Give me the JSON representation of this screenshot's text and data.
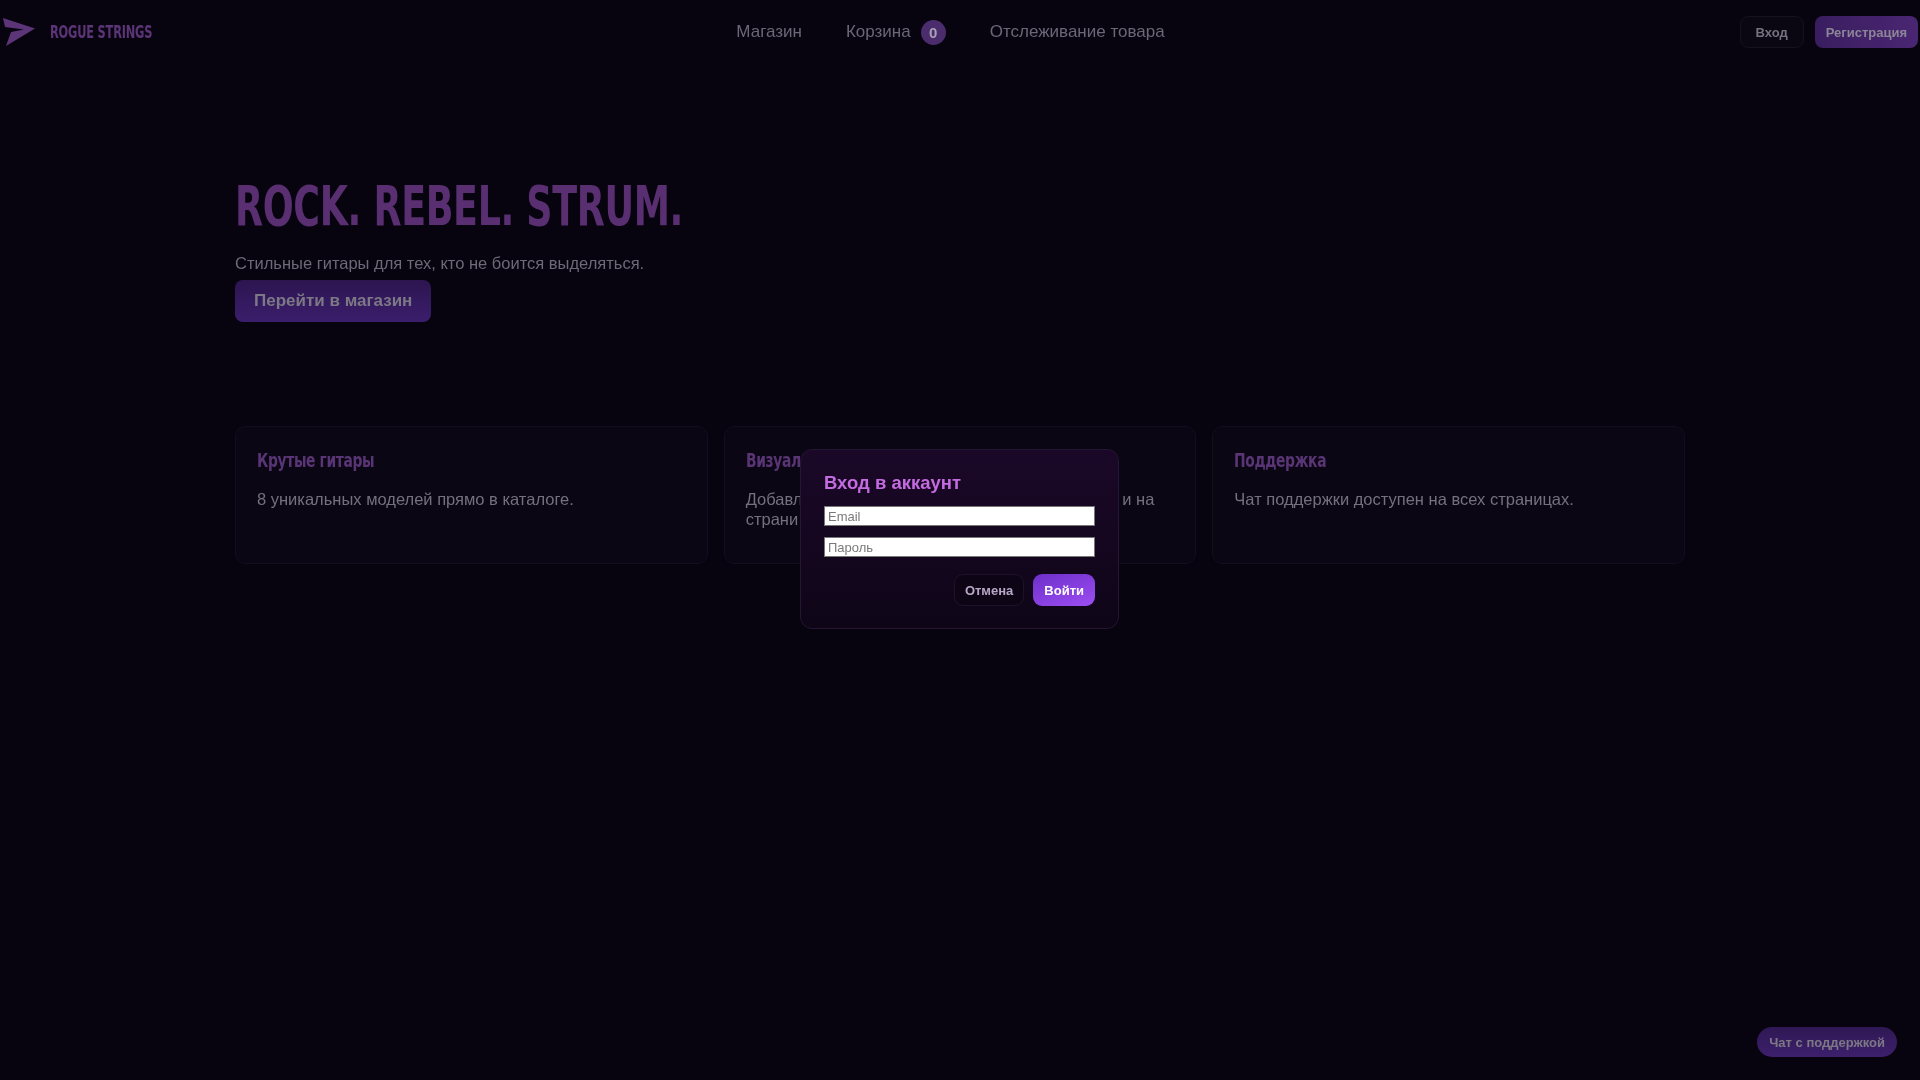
{
  "header": {
    "brand": "ROGUE STRINGS",
    "nav": [
      {
        "label": "Магазин"
      },
      {
        "label": "Корзина",
        "badge": "0"
      },
      {
        "label": "Отслеживание товара"
      }
    ],
    "login_button": "Вход",
    "register_button": "Регистрация"
  },
  "hero": {
    "title": "ROCK. REBEL. STRUM.",
    "subtitle": "Стильные гитары для тех, кто не боится выделяться.",
    "cta": "Перейти в магазин"
  },
  "features": [
    {
      "title": "Крутые гитары",
      "lines": [
        {
          "left": "8 уникальных моделей прямо в каталоге."
        }
      ]
    },
    {
      "title": "Визуал",
      "lines": [
        {
          "left": "Добавл",
          "right": "и на"
        },
        {
          "left": "страни"
        }
      ]
    },
    {
      "title": "Поддержка",
      "lines": [
        {
          "left": "Чат поддержки доступен на всех страницах."
        }
      ]
    }
  ],
  "modal": {
    "title": "Вход в аккаунт",
    "fields": [
      {
        "placeholder": "Email"
      },
      {
        "placeholder": "Пароль"
      }
    ],
    "buttons": [
      {
        "label": "Отмена",
        "kind": "secondary"
      },
      {
        "label": "Войти",
        "kind": "primary"
      }
    ]
  },
  "chat_button": "Чат с поддержкой"
}
